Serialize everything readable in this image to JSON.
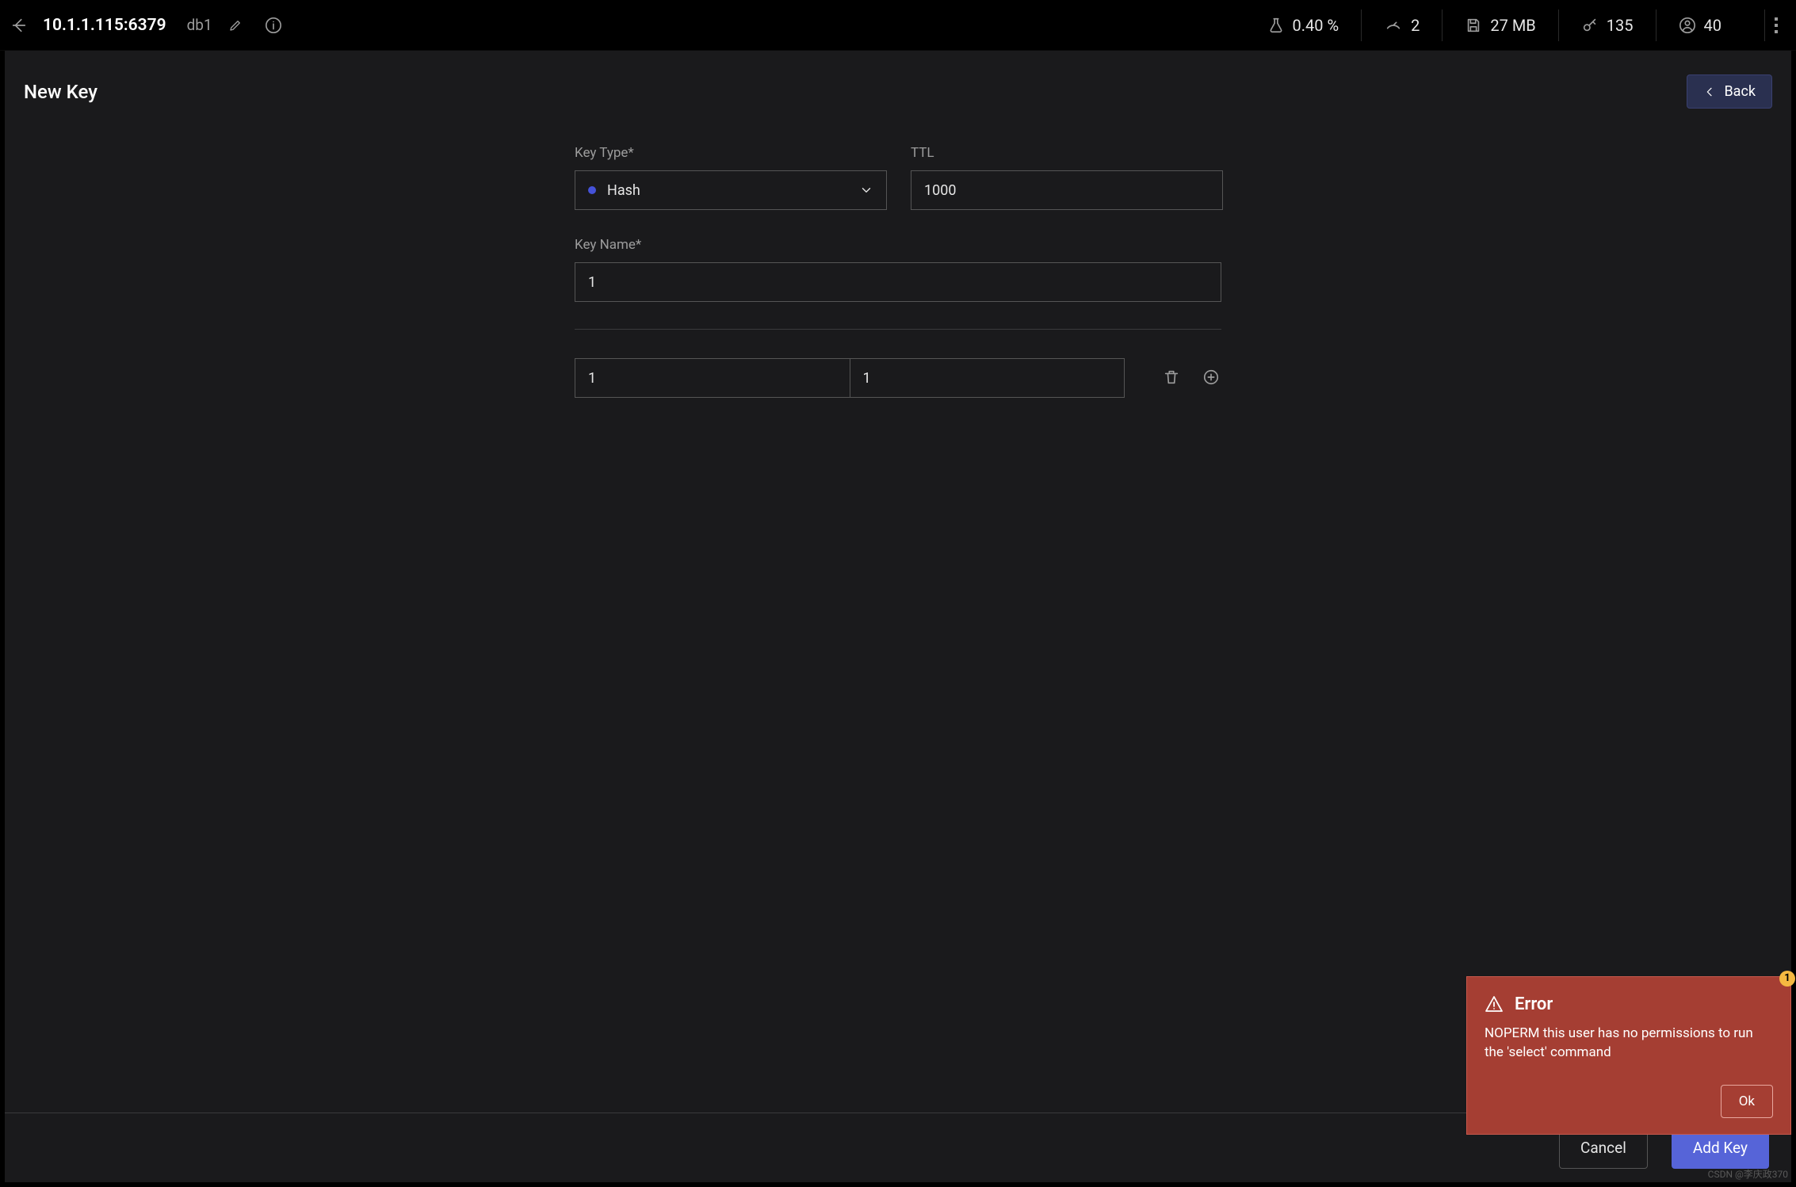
{
  "header": {
    "host": "10.1.1.115:6379",
    "db": "db1"
  },
  "stats": {
    "cpu": "0.40 %",
    "commands": "2",
    "memory": "27 MB",
    "keys": "135",
    "users": "40"
  },
  "page": {
    "title": "New Key",
    "back_label": "Back"
  },
  "form": {
    "key_type_label": "Key Type*",
    "key_type_value": "Hash",
    "ttl_label": "TTL",
    "ttl_value": "1000",
    "key_name_label": "Key Name*",
    "key_name_value": "1",
    "hash_field": "1",
    "hash_value": "1"
  },
  "footer": {
    "cancel": "Cancel",
    "add": "Add Key"
  },
  "error": {
    "title": "Error",
    "message": "NOPERM this user has no permissions to run the 'select' command",
    "ok": "Ok",
    "badge": "1"
  },
  "watermark": "CSDN @李庆政370"
}
